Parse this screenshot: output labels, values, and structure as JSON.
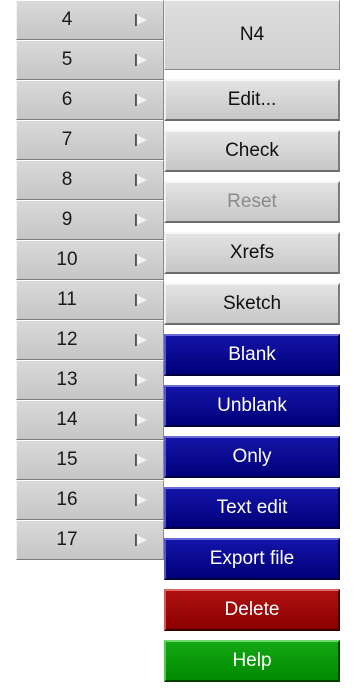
{
  "rows": [
    "4",
    "5",
    "6",
    "7",
    "8",
    "9",
    "10",
    "11",
    "12",
    "13",
    "14",
    "15",
    "16",
    "17"
  ],
  "menu": {
    "title": "N4",
    "items": [
      {
        "label": "Edit...",
        "style": "grey",
        "enabled": true
      },
      {
        "label": "Check",
        "style": "grey",
        "enabled": true
      },
      {
        "label": "Reset",
        "style": "grey",
        "enabled": false
      },
      {
        "label": "Xrefs",
        "style": "grey",
        "enabled": true
      },
      {
        "label": "Sketch",
        "style": "grey",
        "enabled": true
      },
      {
        "label": "Blank",
        "style": "blue",
        "enabled": true
      },
      {
        "label": "Unblank",
        "style": "blue",
        "enabled": true
      },
      {
        "label": "Only",
        "style": "blue",
        "enabled": true
      },
      {
        "label": "Text edit",
        "style": "blue",
        "enabled": true
      },
      {
        "label": "Export file",
        "style": "blue",
        "enabled": true
      },
      {
        "label": "Delete",
        "style": "red",
        "enabled": true
      },
      {
        "label": "Help",
        "style": "green",
        "enabled": true
      }
    ]
  },
  "colors": {
    "menu_blue": "#00008b",
    "menu_red": "#9b0000",
    "menu_green": "#009a00",
    "button_grey": "#d4d4d4",
    "disabled_text": "#8a8a8a"
  },
  "icons": {
    "row_expand": "submenu-arrow-icon"
  }
}
